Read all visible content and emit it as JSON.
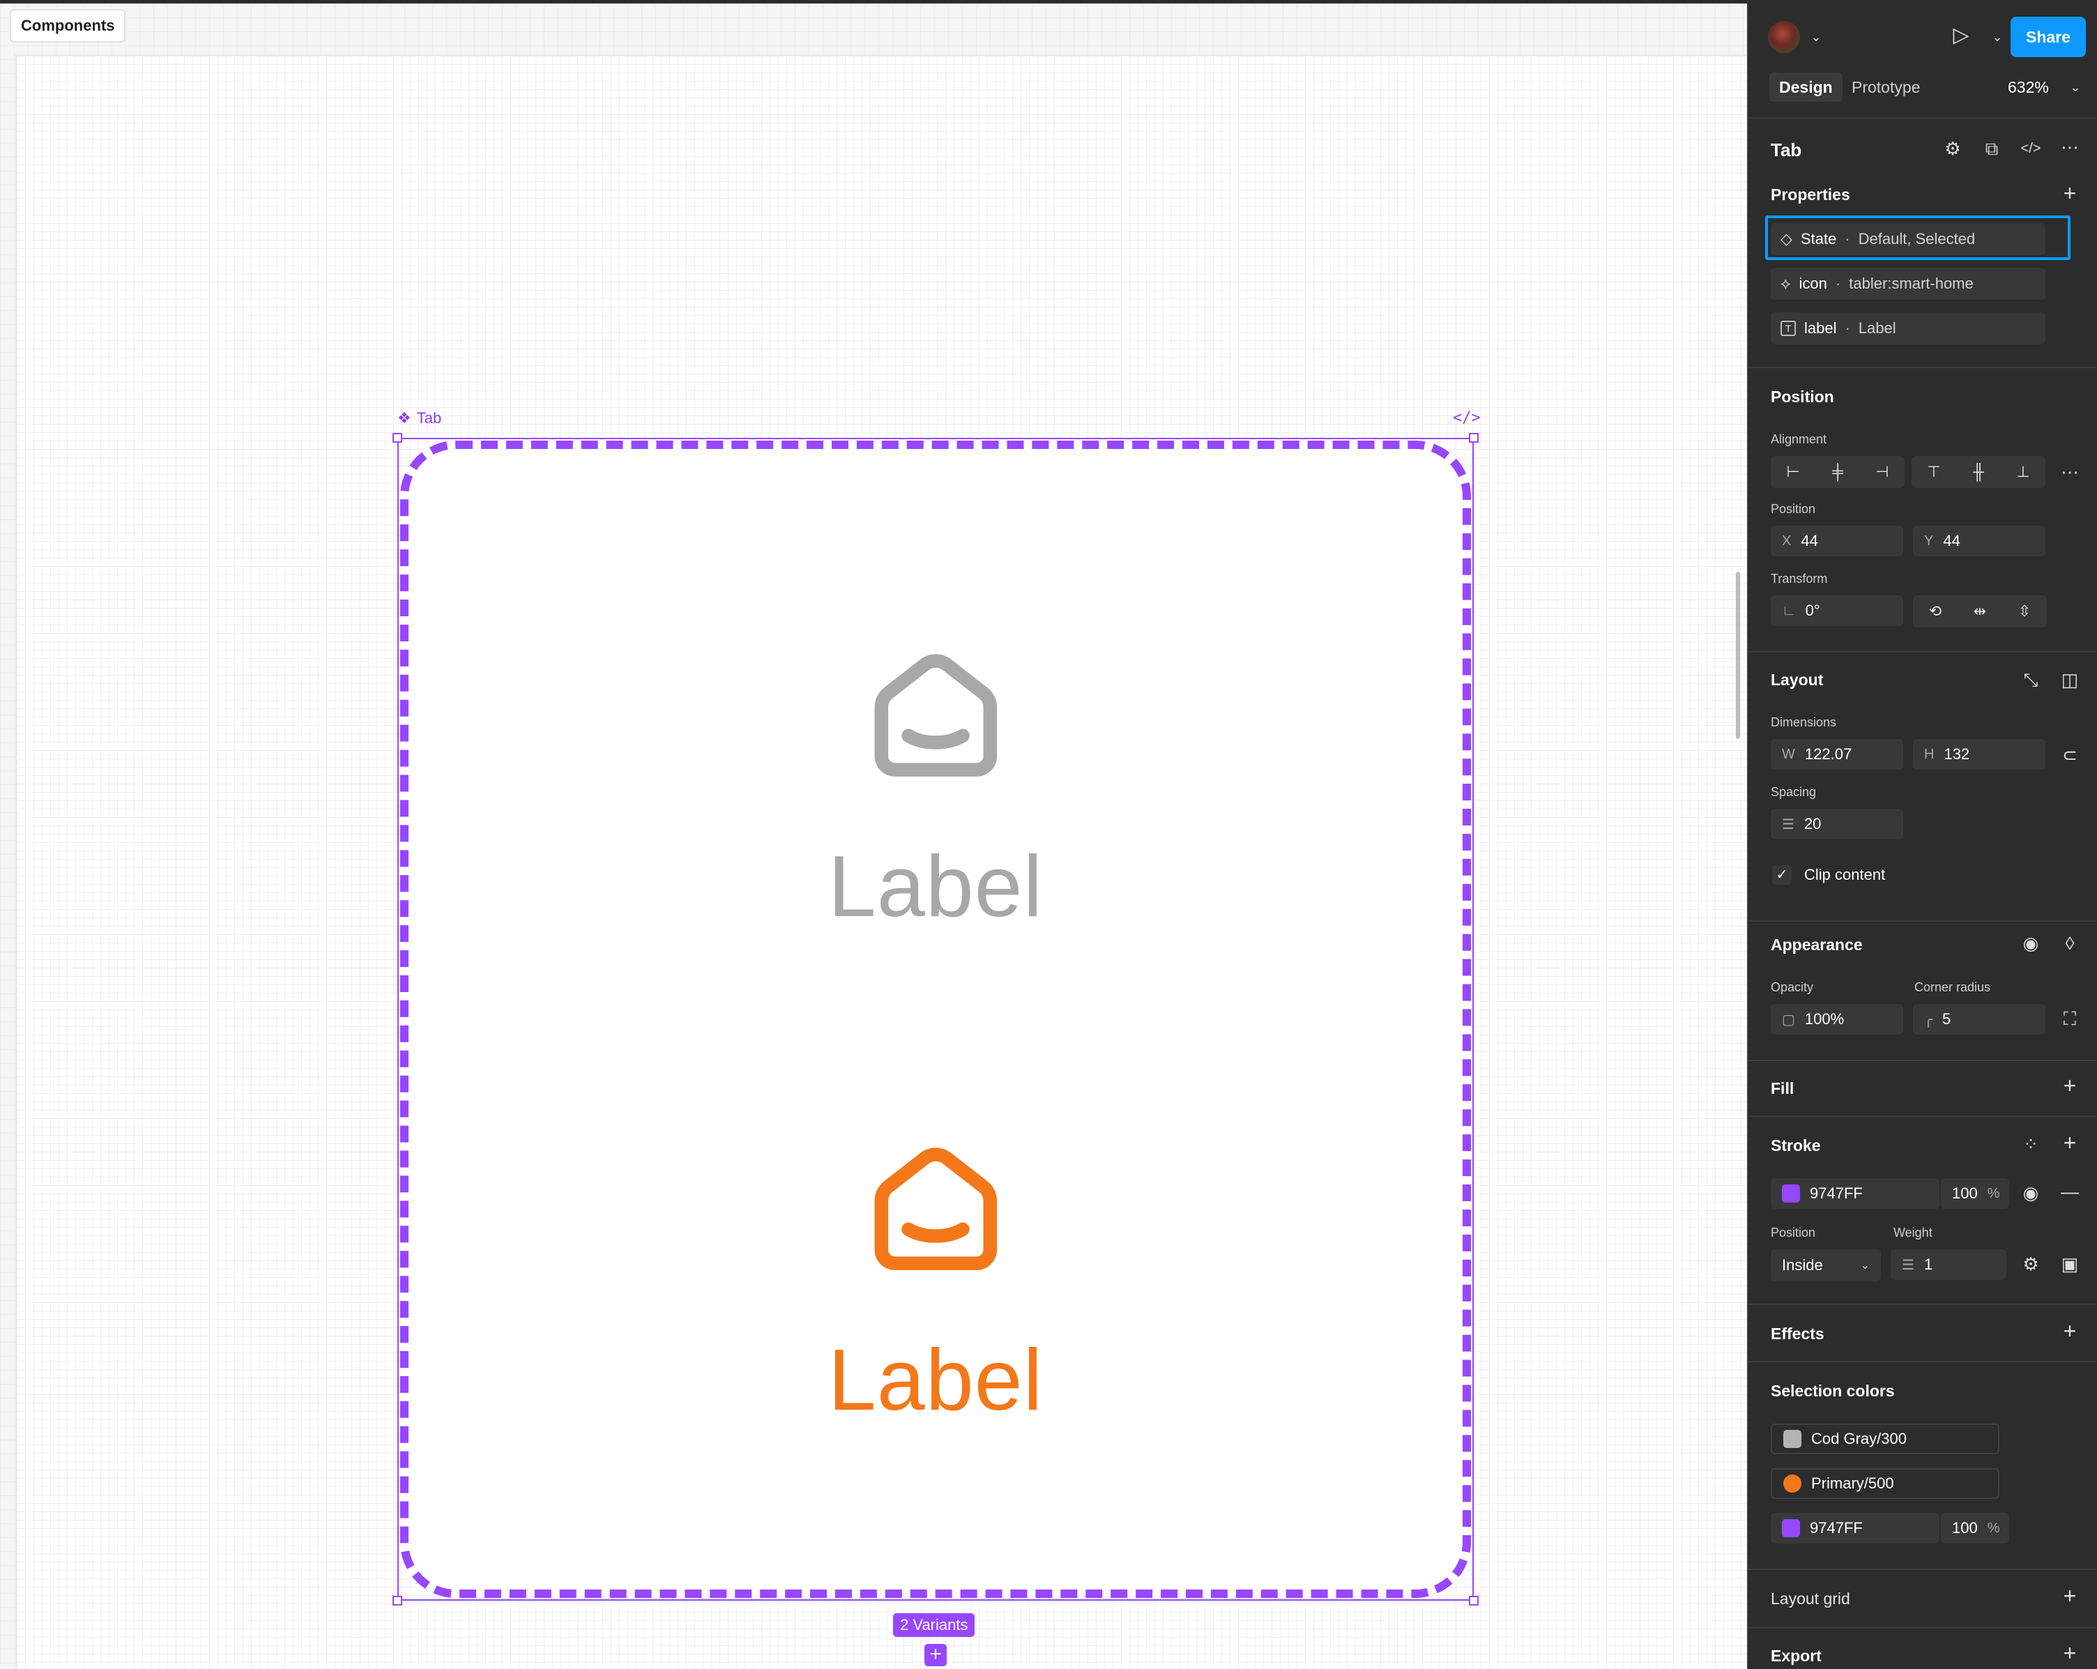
{
  "canvas": {
    "page_tab": "Components",
    "component_set_label": "Tab",
    "code_badge": "</>",
    "variants_count_label": "2 Variants",
    "add_variant_label": "+",
    "variants": [
      {
        "label": "Label",
        "color": "#a8a8a8"
      },
      {
        "label": "Label",
        "color": "#f47819"
      }
    ],
    "stroke_color": "#9747ff"
  },
  "header": {
    "share_label": "Share",
    "tabs": {
      "design": "Design",
      "prototype": "Prototype"
    },
    "zoom": "632%"
  },
  "panel": {
    "component_name": "Tab",
    "properties": {
      "title": "Properties",
      "items": [
        {
          "name": "State",
          "separator": "·",
          "value": "Default, Selected"
        },
        {
          "name": "icon",
          "separator": "·",
          "value": "tabler:smart-home"
        },
        {
          "name": "label",
          "separator": "·",
          "value": "Label"
        }
      ]
    },
    "position": {
      "title": "Position",
      "alignment_label": "Alignment",
      "position_label": "Position",
      "x_prefix": "X",
      "x": "44",
      "y_prefix": "Y",
      "y": "44",
      "transform_label": "Transform",
      "rotation": "0°"
    },
    "layout": {
      "title": "Layout",
      "dimensions_label": "Dimensions",
      "w_prefix": "W",
      "w": "122.07",
      "h_prefix": "H",
      "h": "132",
      "spacing_label": "Spacing",
      "spacing": "20",
      "clip_content_label": "Clip content"
    },
    "appearance": {
      "title": "Appearance",
      "opacity_label": "Opacity",
      "opacity": "100%",
      "corner_radius_label": "Corner radius",
      "corner_radius": "5"
    },
    "fill": {
      "title": "Fill"
    },
    "stroke": {
      "title": "Stroke",
      "color_hex": "9747FF",
      "color": "#9747ff",
      "opacity": "100",
      "percent": "%",
      "position_label": "Position",
      "position_value": "Inside",
      "weight_label": "Weight",
      "weight": "1"
    },
    "effects": {
      "title": "Effects"
    },
    "selection_colors": {
      "title": "Selection colors",
      "items": [
        {
          "name": "Cod Gray/300",
          "color": "#b4b4b4"
        },
        {
          "name": "Primary/500",
          "color": "#f47819"
        },
        {
          "name": "9747FF",
          "color": "#9747ff",
          "opacity": "100",
          "percent": "%"
        }
      ]
    },
    "layout_grid": {
      "title": "Layout grid"
    },
    "export": {
      "title": "Export"
    }
  }
}
